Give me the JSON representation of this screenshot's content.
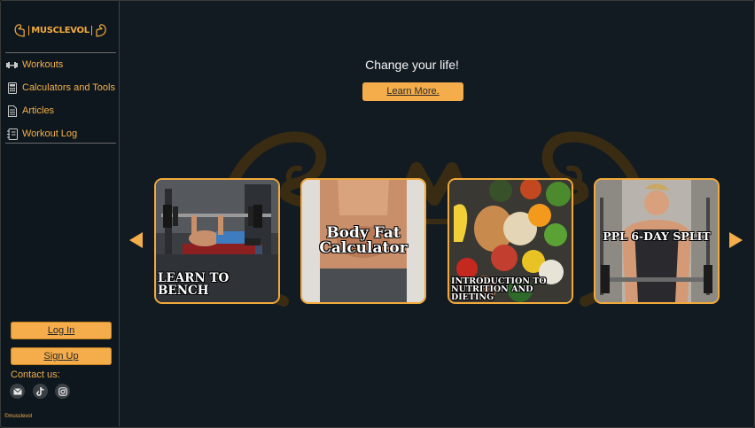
{
  "brand": {
    "name": "MUSCLEVOL"
  },
  "sidebar": {
    "items": [
      {
        "label": "Workouts",
        "icon": "dumbbell-icon"
      },
      {
        "label": "Calculators and Tools",
        "icon": "calculator-icon"
      },
      {
        "label": "Articles",
        "icon": "document-icon"
      },
      {
        "label": "Workout Log",
        "icon": "notebook-icon"
      }
    ],
    "login_label": "Log In",
    "signup_label": "Sign Up",
    "contact_label": "Contact us:",
    "social": [
      "email-icon",
      "tiktok-icon",
      "instagram-icon"
    ],
    "copyright": "©musclevol"
  },
  "hero": {
    "headline": "Change your life!",
    "cta_label": "Learn More."
  },
  "carousel": {
    "cards": [
      {
        "title": "LEARN TO BENCH"
      },
      {
        "title": "Body Fat Calculator"
      },
      {
        "title": "INTRODUCTION TO NUTRITION AND DIETING"
      },
      {
        "title": "PPL 6-DAY SPLIT"
      }
    ]
  },
  "colors": {
    "accent": "#f4ad4a",
    "background": "#131b22",
    "sidebar": "#0f171e",
    "card_border": "#f2a93b"
  }
}
